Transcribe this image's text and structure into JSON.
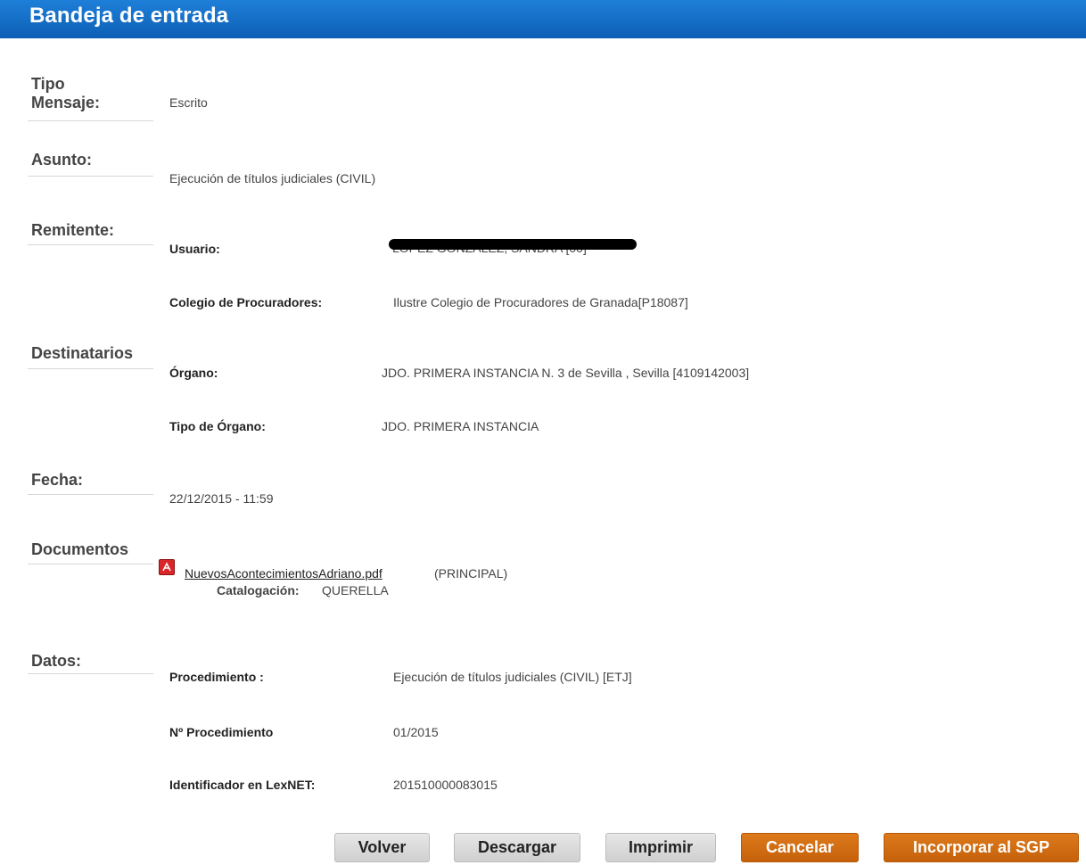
{
  "header": {
    "title": "Bandeja de entrada"
  },
  "sections": {
    "tipo_mensaje": {
      "label_line1": "Tipo",
      "label_line2": "Mensaje:",
      "value": "Escrito"
    },
    "asunto": {
      "label": "Asunto:",
      "value": "Ejecución de títulos judiciales (CIVIL)"
    },
    "remitente": {
      "label": "Remitente:",
      "usuario_label": "Usuario:",
      "usuario_value": "LÓPEZ GONZÁLEZ, SANDRA [00]",
      "colegio_label": "Colegio de Procuradores:",
      "colegio_value": "Ilustre Colegio de Procuradores de Granada[P18087]"
    },
    "destinatarios": {
      "label": "Destinatarios",
      "organo_label": "Órgano:",
      "organo_value": "JDO. PRIMERA INSTANCIA N. 3 de Sevilla , Sevilla [4109142003]",
      "tipo_organo_label": "Tipo de Órgano:",
      "tipo_organo_value": "JDO. PRIMERA INSTANCIA"
    },
    "fecha": {
      "label": "Fecha:",
      "value": "22/12/2015 - 11:59"
    },
    "documentos": {
      "label": "Documentos",
      "file_name": "NuevosAcontecimientosAdriano.pdf",
      "file_tag": "(PRINCIPAL)",
      "catalog_label": "Catalogación:",
      "catalog_value": "QUERELLA",
      "file_icon": "pdf-icon"
    },
    "datos": {
      "label": "Datos:",
      "procedimiento_label": "Procedimiento :",
      "procedimiento_value": "Ejecución de títulos judiciales (CIVIL) [ETJ]",
      "num_label": "Nº Procedimiento",
      "num_value": "01/2015",
      "lexnet_label": "Identificador en LexNET:",
      "lexnet_value": "201510000083015"
    }
  },
  "buttons": {
    "volver": "Volver",
    "descargar": "Descargar",
    "imprimir": "Imprimir",
    "cancelar": "Cancelar",
    "incorporar": "Incorporar al SGP"
  },
  "colors": {
    "header_blue": "#1474d0",
    "button_orange": "#d06c12",
    "button_gray": "#d8d8d8"
  }
}
